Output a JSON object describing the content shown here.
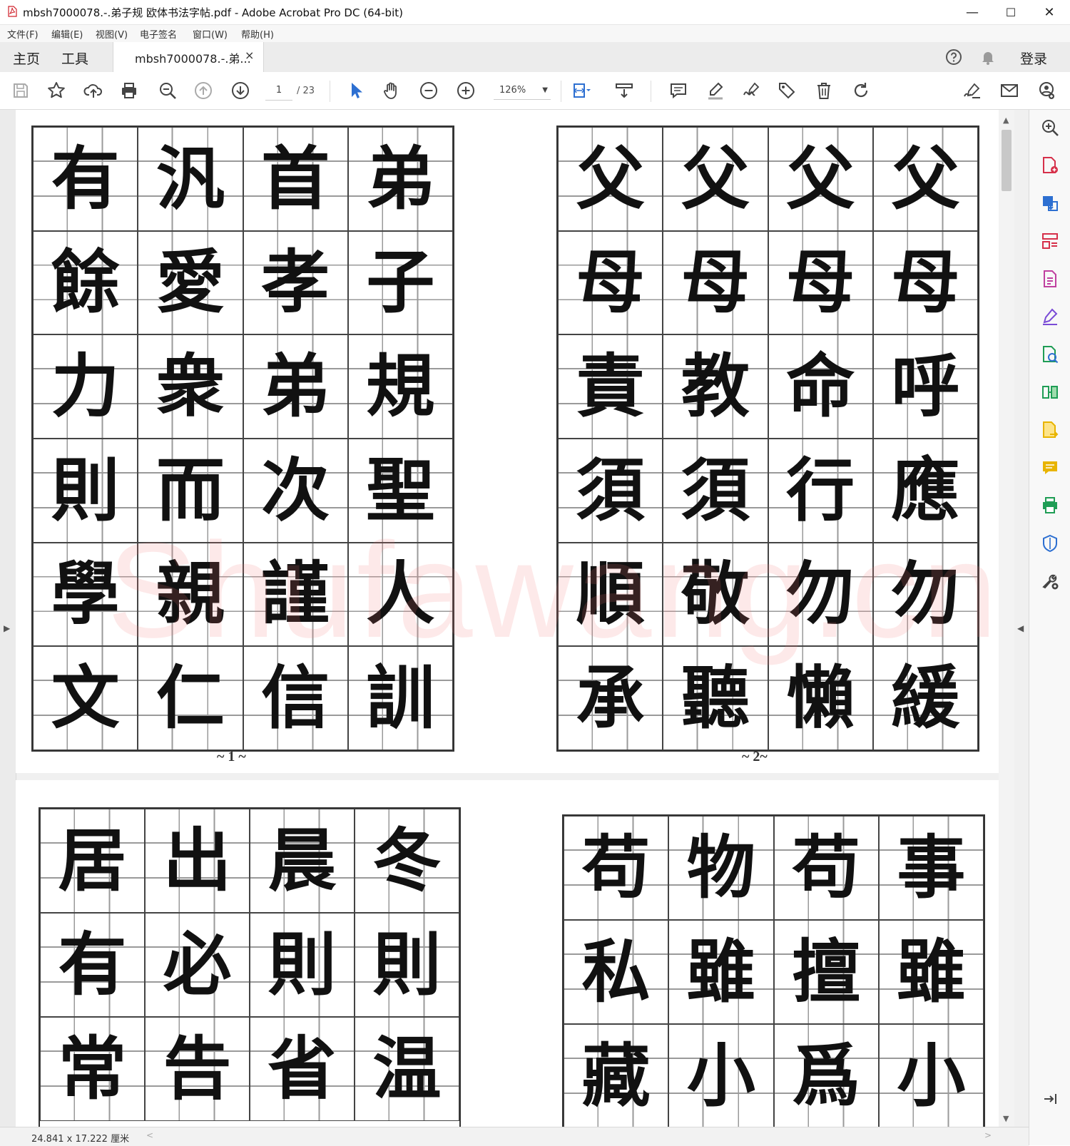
{
  "window": {
    "title": "mbsh7000078.-.弟子规 欧体书法字帖.pdf - Adobe Acrobat Pro DC (64-bit)",
    "minimize": "—",
    "maximize": "☐",
    "close": "✕"
  },
  "menu": [
    "文件(F)",
    "编辑(E)",
    "视图(V)",
    "电子签名",
    "窗口(W)",
    "帮助(H)"
  ],
  "tabs": {
    "home": "主页",
    "tools": "工具",
    "document": "mbsh7000078.-.弟...",
    "document_close": "×",
    "login": "登录"
  },
  "toolbar": {
    "page_current": "1",
    "page_total": "/ 23",
    "zoom": "126%"
  },
  "pages": [
    {
      "number": "~ 1 ~",
      "rows": [
        [
          "有",
          "汎",
          "首",
          "弟"
        ],
        [
          "餘",
          "愛",
          "孝",
          "子"
        ],
        [
          "力",
          "衆",
          "弟",
          "規"
        ],
        [
          "則",
          "而",
          "次",
          "聖"
        ],
        [
          "學",
          "親",
          "謹",
          "人"
        ],
        [
          "文",
          "仁",
          "信",
          "訓"
        ]
      ]
    },
    {
      "number": "~ 2~",
      "rows": [
        [
          "父",
          "父",
          "父",
          "父"
        ],
        [
          "母",
          "母",
          "母",
          "母"
        ],
        [
          "責",
          "教",
          "命",
          "呼"
        ],
        [
          "須",
          "須",
          "行",
          "應"
        ],
        [
          "順",
          "敬",
          "勿",
          "勿"
        ],
        [
          "承",
          "聽",
          "懶",
          "緩"
        ]
      ]
    },
    {
      "rows": [
        [
          "居",
          "出",
          "晨",
          "冬"
        ],
        [
          "有",
          "必",
          "則",
          "則"
        ],
        [
          "常",
          "告",
          "省",
          "温"
        ]
      ]
    },
    {
      "rows": [
        [
          "苟",
          "物",
          "苟",
          "事"
        ],
        [
          "私",
          "雖",
          "擅",
          "雖"
        ],
        [
          "藏",
          "小",
          "爲",
          "小"
        ]
      ]
    }
  ],
  "watermark": "Shufawang.cn",
  "status": {
    "dimensions": "24.841 x 17.222 厘米"
  },
  "icons": {
    "toolbar": [
      "save-icon",
      "bookmark-star-icon",
      "upload-cloud-icon",
      "print-icon",
      "find-zoom-icon",
      "prev-page-icon",
      "next-page-icon",
      "select-cursor-icon",
      "hand-tool-icon",
      "zoom-out-icon",
      "zoom-in-icon",
      "fit-page-icon",
      "scrolling-mode-icon",
      "comment-icon",
      "highlight-pen-icon",
      "sign-icon",
      "stamp-tag-icon",
      "delete-icon",
      "rotate-icon",
      "fill-sign-icon",
      "email-icon",
      "share-user-icon"
    ],
    "right_panel": [
      "enhance-scan-icon",
      "create-pdf-icon",
      "export-pdf-icon",
      "organize-pages-icon",
      "edit-pdf-icon",
      "fill-sign-panel-icon",
      "compare-files-icon",
      "combine-files-icon",
      "export-doc-icon",
      "comment-panel-icon",
      "print-production-icon",
      "protect-shield-icon",
      "more-tools-icon",
      "collapse-panel-icon"
    ]
  },
  "colors": {
    "accent_blue": "#2d6fd1",
    "tool_purple": "#7a4cd6",
    "tool_red": "#d6304a",
    "tool_green": "#1f9d55",
    "tool_yellow": "#e8b400"
  }
}
